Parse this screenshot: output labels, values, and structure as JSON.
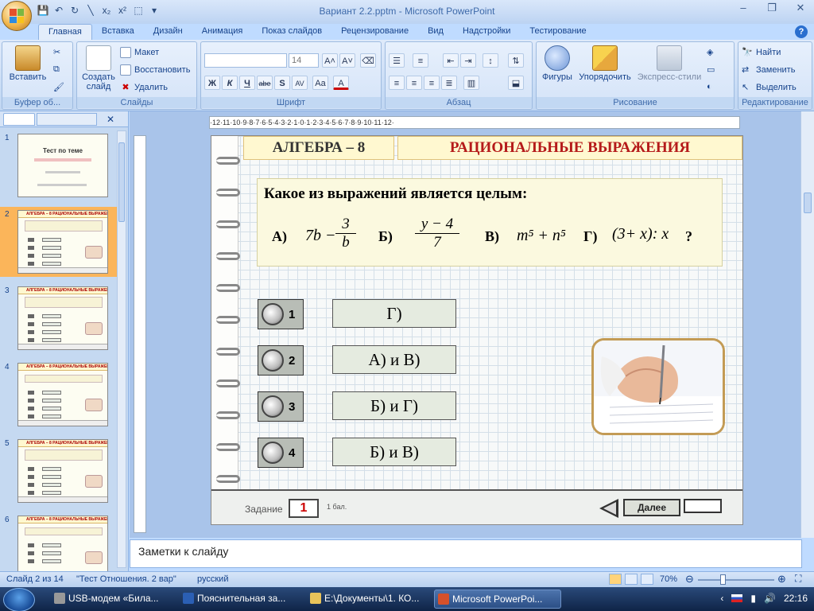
{
  "window": {
    "title": "Вариант 2.2.pptm - Microsoft PowerPoint"
  },
  "qat": {
    "icons": [
      "save-icon",
      "undo-icon",
      "redo-icon",
      "line-icon",
      "subscript-icon",
      "superscript-icon",
      "select-icon",
      "customize-icon"
    ],
    "sub": "x₂",
    "sup": "x²"
  },
  "tabs": [
    "Главная",
    "Вставка",
    "Дизайн",
    "Анимация",
    "Показ слайдов",
    "Рецензирование",
    "Вид",
    "Надстройки",
    "Тестирование"
  ],
  "ribbon": {
    "clipboard": {
      "label": "Буфер об...",
      "paste": "Вставить"
    },
    "slides": {
      "label": "Слайды",
      "new_slide": "Создать слайд",
      "layout": "Макет",
      "reset": "Восстановить",
      "delete": "Удалить"
    },
    "font": {
      "label": "Шрифт",
      "size": "14",
      "bold": "Ж",
      "italic": "К",
      "underline": "Ч",
      "strike": "abe",
      "shadow": "S",
      "spacing": "AV",
      "case": "Aa",
      "color": "A"
    },
    "paragraph": {
      "label": "Абзац"
    },
    "drawing": {
      "label": "Рисование",
      "shapes": "Фигуры",
      "arrange": "Упорядочить",
      "styles": "Экспресс-стили"
    },
    "editing": {
      "label": "Редактирование",
      "find": "Найти",
      "replace": "Заменить",
      "select": "Выделить"
    }
  },
  "ruler": {
    "h": "·12·11·10·9·8·7·6·5·4·3·2·1·0·1·2·3·4·5·6·7·8·9·10·11·12·"
  },
  "thumbs": [
    {
      "num": "1",
      "title": "Тест по теме"
    },
    {
      "num": "2",
      "title": "АЛГЕБРА – 8   РАЦИОНАЛЬНЫЕ ВЫРАЖЕНИЯ"
    },
    {
      "num": "3",
      "title": "АЛГЕБРА – 8   РАЦИОНАЛЬНЫЕ ВЫРАЖЕНИЯ"
    },
    {
      "num": "4",
      "title": "АЛГЕБРА – 8   РАЦИОНАЛЬНЫЕ ВЫРАЖЕНИЯ"
    },
    {
      "num": "5",
      "title": "АЛГЕБРА – 8   РАЦИОНАЛЬНЫЕ ВЫРАЖЕНИЯ"
    },
    {
      "num": "6",
      "title": "АЛГЕБРА – 8   РАЦИОНАЛЬНЫЕ ВЫРАЖЕНИЯ"
    }
  ],
  "slide": {
    "header_left": "АЛГЕБРА – 8",
    "header_right": "РАЦИОНАЛЬНЫЕ ВЫРАЖЕНИЯ",
    "question": "Какое из выражений является целым:",
    "options": {
      "a_label": "А)",
      "a_expr_lead": "7b −",
      "a_num": "3",
      "a_den": "b",
      "b_label": "Б)",
      "b_num": "y − 4",
      "b_den": "7",
      "v_label": "В)",
      "v_expr": "m⁵ + n⁵",
      "g_label": "Г)",
      "g_expr": "(3+ x): x",
      "qmark": "?"
    },
    "answers": [
      {
        "n": "1",
        "text": "Г)"
      },
      {
        "n": "2",
        "text": "А) и В)"
      },
      {
        "n": "3",
        "text": "Б) и Г)"
      },
      {
        "n": "4",
        "text": "Б) и В)"
      }
    ],
    "footer": {
      "task_label": "Задание",
      "task_num": "1",
      "points": "1 бал.",
      "next": "Далее"
    }
  },
  "notes": "Заметки к слайду",
  "status": {
    "slide": "Слайд 2 из 14",
    "theme": "\"Тест Отношения.  2 вар\"",
    "lang": "русский",
    "zoom": "70%"
  },
  "taskbar": {
    "items": [
      "USB-модем «Била...",
      "Пояснительная за...",
      "E:\\Документы\\1. КО...",
      "Microsoft PowerPoi..."
    ],
    "time": "22:16"
  }
}
